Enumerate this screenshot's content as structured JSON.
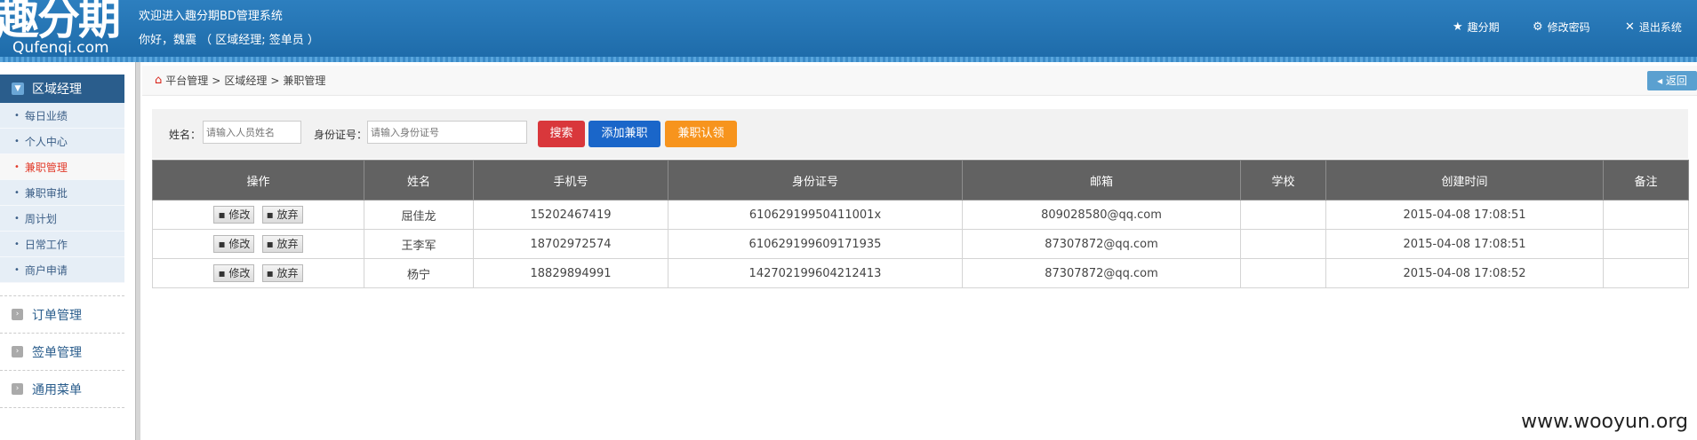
{
  "header": {
    "logo_cn": "趣分期",
    "logo_en": "Qufenqi.com",
    "welcome": "欢迎进入趣分期BD管理系统",
    "greeting": "你好，魏震 （ 区域经理; 签单员 ）",
    "links": [
      {
        "icon": "star-icon",
        "label": "趣分期"
      },
      {
        "icon": "gear-icon",
        "label": "修改密码"
      },
      {
        "icon": "close-icon",
        "label": "退出系统"
      }
    ]
  },
  "sidebar": {
    "active_section": "区域经理",
    "items": [
      "每日业绩",
      "个人中心",
      "兼职管理",
      "兼职审批",
      "周计划",
      "日常工作",
      "商户申请"
    ],
    "active_item": "兼职管理",
    "sections": [
      "订单管理",
      "签单管理",
      "通用菜单"
    ]
  },
  "breadcrumb": [
    "平台管理",
    "区域经理",
    "兼职管理"
  ],
  "back_label": "返回",
  "search": {
    "name_label": "姓名：",
    "name_placeholder": "请输入人员姓名",
    "id_label": "身份证号：",
    "id_placeholder": "请输入身份证号",
    "search_btn": "搜索",
    "add_btn": "添加兼职",
    "claim_btn": "兼职认领"
  },
  "table": {
    "columns": [
      "操作",
      "姓名",
      "手机号",
      "身份证号",
      "邮箱",
      "学校",
      "创建时间",
      "备注"
    ],
    "edit_label": "修改",
    "abandon_label": "放弃",
    "rows": [
      {
        "name": "屈佳龙",
        "phone": "15202467419",
        "id": "61062919950411001x",
        "email": "809028580@qq.com",
        "school": "",
        "created": "2015-04-08 17:08:51",
        "note": ""
      },
      {
        "name": "王李军",
        "phone": "18702972574",
        "id": "610629199609171935",
        "email": "87307872@qq.com",
        "school": "",
        "created": "2015-04-08 17:08:51",
        "note": ""
      },
      {
        "name": "杨宁",
        "phone": "18829894991",
        "id": "142702199604212413",
        "email": "87307872@qq.com",
        "school": "",
        "created": "2015-04-08 17:08:52",
        "note": ""
      }
    ]
  },
  "watermark": "www.wooyun.org",
  "colors": {
    "header": "#1d6aa8",
    "sidebar_active": "#2a5d8c",
    "search_btn": "#d9373b",
    "add_btn": "#1a66c9",
    "claim_btn": "#f7941d",
    "table_header": "#626262"
  }
}
